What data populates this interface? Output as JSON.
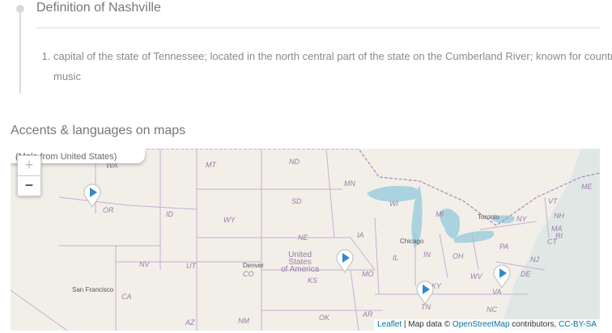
{
  "definition": {
    "title": "Definition of Nashville",
    "items": [
      "capital of the state of Tennessee; located in the north central part of the state on the Cumberland River; known for country music"
    ]
  },
  "map_section": {
    "title": "Accents & languages on maps",
    "popup_text": "(Male from United States)",
    "zoom_in": "+",
    "zoom_out": "−",
    "attribution": {
      "leaflet": "Leaflet",
      "sep": " | Map data © ",
      "osm": "OpenStreetMap",
      "contrib": " contributors, ",
      "license": "CC-BY-SA"
    },
    "states": [
      "WA",
      "MT",
      "ND",
      "MN",
      "ME",
      "VT",
      "OR",
      "ID",
      "WY",
      "SD",
      "WI",
      "MI",
      "NY",
      "NH",
      "MA",
      "RI",
      "CT",
      "NV",
      "UT",
      "NE",
      "IA",
      "IL",
      "IN",
      "OH",
      "PA",
      "NJ",
      "CA",
      "CO",
      "KS",
      "MO",
      "KY",
      "WV",
      "VA",
      "DE",
      "TN",
      "NC",
      "AZ",
      "NM",
      "OK",
      "AR"
    ],
    "cities": [
      "Toronto",
      "Chicago",
      "Denver",
      "San Francisco"
    ],
    "country_label": [
      "United",
      "States",
      "of America"
    ],
    "marker_color": "#3388cc",
    "water_color": "#aad3df",
    "land_color": "#f2efe9"
  }
}
